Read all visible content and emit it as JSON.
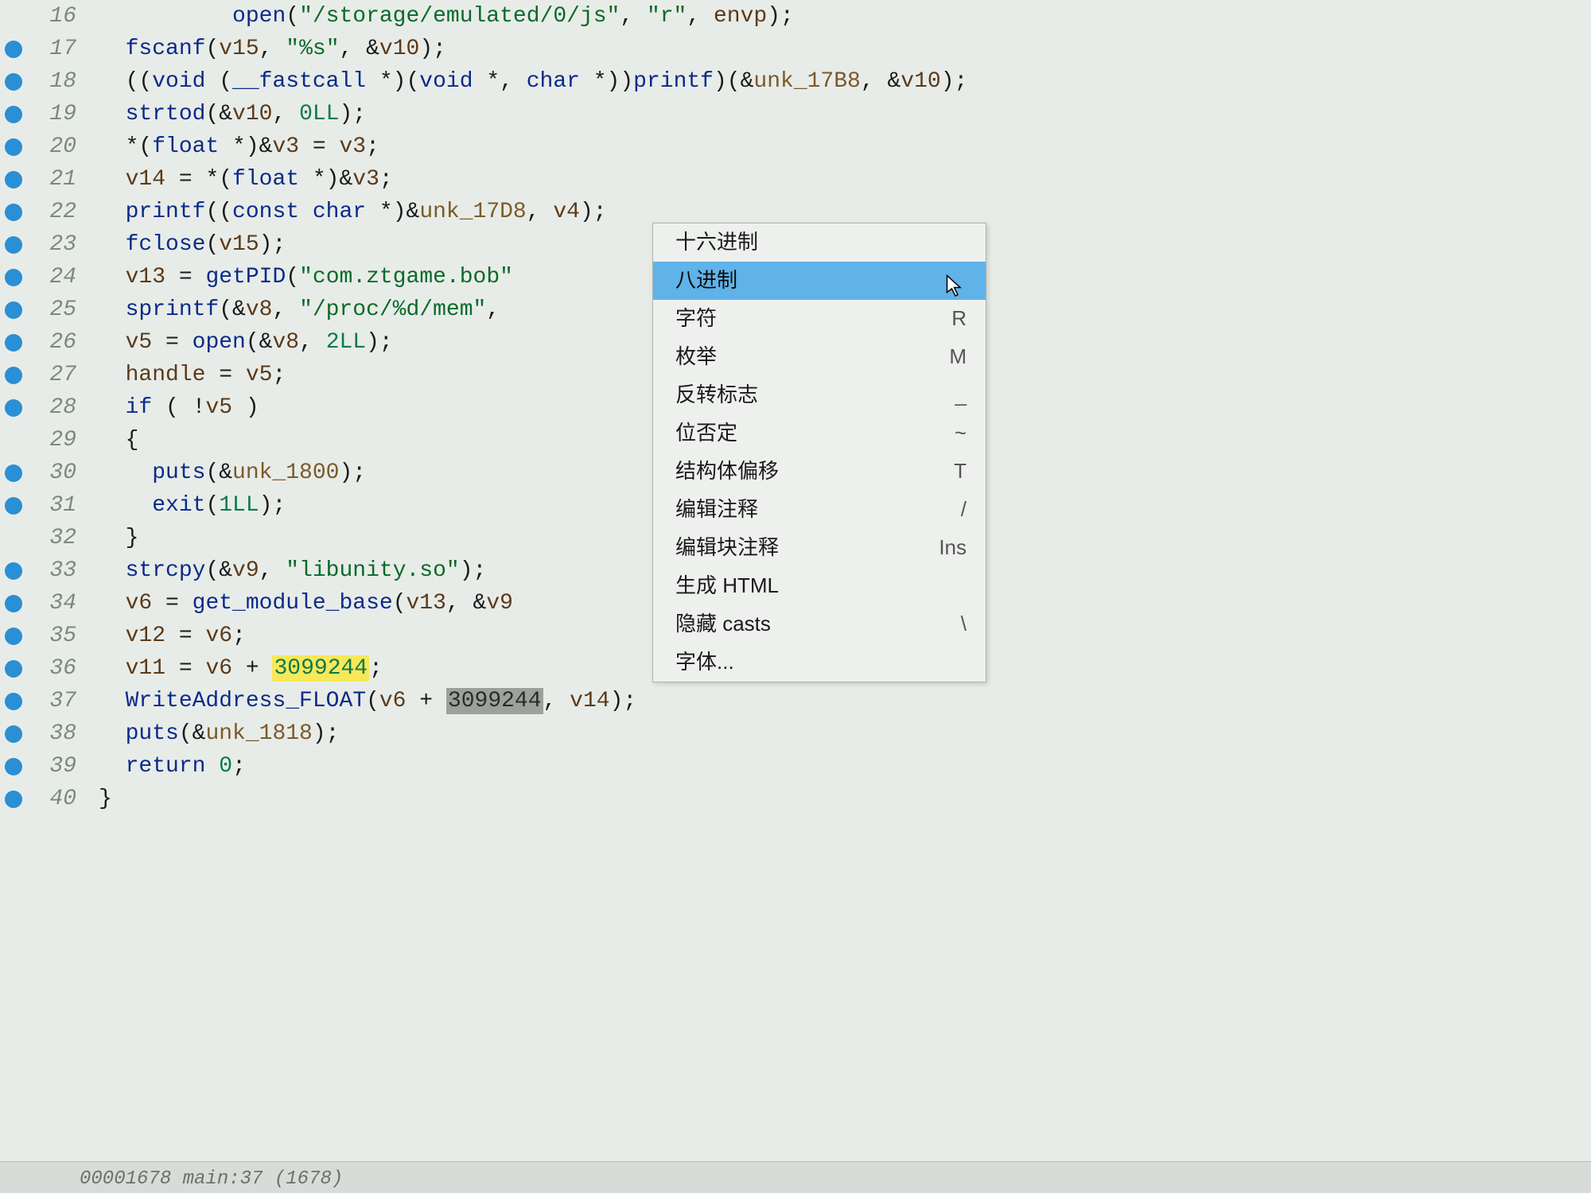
{
  "lines": [
    {
      "n": 16,
      "bp": false,
      "tokens": [
        {
          "t": "        ",
          "c": ""
        },
        {
          "t": "open",
          "c": "fn"
        },
        {
          "t": "(",
          "c": ""
        },
        {
          "t": "\"/storage/emulated/0/js\"",
          "c": "str"
        },
        {
          "t": ", ",
          "c": ""
        },
        {
          "t": "\"r\"",
          "c": "str"
        },
        {
          "t": ", ",
          "c": ""
        },
        {
          "t": "envp",
          "c": "var"
        },
        {
          "t": ");",
          "c": ""
        }
      ]
    },
    {
      "n": 17,
      "bp": true,
      "tokens": [
        {
          "t": "fscanf",
          "c": "fn"
        },
        {
          "t": "(",
          "c": ""
        },
        {
          "t": "v15",
          "c": "var"
        },
        {
          "t": ", ",
          "c": ""
        },
        {
          "t": "\"%s\"",
          "c": "str"
        },
        {
          "t": ", &",
          "c": ""
        },
        {
          "t": "v10",
          "c": "var"
        },
        {
          "t": ");",
          "c": ""
        }
      ]
    },
    {
      "n": 18,
      "bp": true,
      "tokens": [
        {
          "t": "((",
          "c": ""
        },
        {
          "t": "void",
          "c": "type"
        },
        {
          "t": " (",
          "c": ""
        },
        {
          "t": "__fastcall",
          "c": "type"
        },
        {
          "t": " *)(",
          "c": ""
        },
        {
          "t": "void",
          "c": "type"
        },
        {
          "t": " *, ",
          "c": ""
        },
        {
          "t": "char",
          "c": "type"
        },
        {
          "t": " *))",
          "c": ""
        },
        {
          "t": "printf",
          "c": "fn"
        },
        {
          "t": ")(&",
          "c": ""
        },
        {
          "t": "unk_17B8",
          "c": "ref"
        },
        {
          "t": ", &",
          "c": ""
        },
        {
          "t": "v10",
          "c": "var"
        },
        {
          "t": ");",
          "c": ""
        }
      ]
    },
    {
      "n": 19,
      "bp": true,
      "tokens": [
        {
          "t": "strtod",
          "c": "fn"
        },
        {
          "t": "(&",
          "c": ""
        },
        {
          "t": "v10",
          "c": "var"
        },
        {
          "t": ", ",
          "c": ""
        },
        {
          "t": "0LL",
          "c": "num"
        },
        {
          "t": ");",
          "c": ""
        }
      ]
    },
    {
      "n": 20,
      "bp": true,
      "tokens": [
        {
          "t": "*(",
          "c": ""
        },
        {
          "t": "float",
          "c": "type"
        },
        {
          "t": " *)&",
          "c": ""
        },
        {
          "t": "v3",
          "c": "var"
        },
        {
          "t": " = ",
          "c": ""
        },
        {
          "t": "v3",
          "c": "var"
        },
        {
          "t": ";",
          "c": ""
        }
      ]
    },
    {
      "n": 21,
      "bp": true,
      "tokens": [
        {
          "t": "v14",
          "c": "var"
        },
        {
          "t": " = *(",
          "c": ""
        },
        {
          "t": "float",
          "c": "type"
        },
        {
          "t": " *)&",
          "c": ""
        },
        {
          "t": "v3",
          "c": "var"
        },
        {
          "t": ";",
          "c": ""
        }
      ]
    },
    {
      "n": 22,
      "bp": true,
      "tokens": [
        {
          "t": "printf",
          "c": "fn"
        },
        {
          "t": "((",
          "c": ""
        },
        {
          "t": "const",
          "c": "type"
        },
        {
          "t": " ",
          "c": ""
        },
        {
          "t": "char",
          "c": "type"
        },
        {
          "t": " *)&",
          "c": ""
        },
        {
          "t": "unk_17D8",
          "c": "ref"
        },
        {
          "t": ", ",
          "c": ""
        },
        {
          "t": "v4",
          "c": "var"
        },
        {
          "t": ");",
          "c": ""
        }
      ]
    },
    {
      "n": 23,
      "bp": true,
      "tokens": [
        {
          "t": "fclose",
          "c": "fn"
        },
        {
          "t": "(",
          "c": ""
        },
        {
          "t": "v15",
          "c": "var"
        },
        {
          "t": ");",
          "c": ""
        }
      ]
    },
    {
      "n": 24,
      "bp": true,
      "tokens": [
        {
          "t": "v13",
          "c": "var"
        },
        {
          "t": " = ",
          "c": ""
        },
        {
          "t": "getPID",
          "c": "fn"
        },
        {
          "t": "(",
          "c": ""
        },
        {
          "t": "\"com.ztgame.bob\"",
          "c": "str"
        }
      ]
    },
    {
      "n": 25,
      "bp": true,
      "tokens": [
        {
          "t": "sprintf",
          "c": "fn"
        },
        {
          "t": "(&",
          "c": ""
        },
        {
          "t": "v8",
          "c": "var"
        },
        {
          "t": ", ",
          "c": ""
        },
        {
          "t": "\"/proc/%d/mem\"",
          "c": "str"
        },
        {
          "t": ",",
          "c": ""
        }
      ]
    },
    {
      "n": 26,
      "bp": true,
      "tokens": [
        {
          "t": "v5",
          "c": "var"
        },
        {
          "t": " = ",
          "c": ""
        },
        {
          "t": "open",
          "c": "fn"
        },
        {
          "t": "(&",
          "c": ""
        },
        {
          "t": "v8",
          "c": "var"
        },
        {
          "t": ", ",
          "c": ""
        },
        {
          "t": "2LL",
          "c": "num"
        },
        {
          "t": ");",
          "c": ""
        }
      ]
    },
    {
      "n": 27,
      "bp": true,
      "tokens": [
        {
          "t": "handle",
          "c": "var"
        },
        {
          "t": " = ",
          "c": ""
        },
        {
          "t": "v5",
          "c": "var"
        },
        {
          "t": ";",
          "c": ""
        }
      ]
    },
    {
      "n": 28,
      "bp": true,
      "tokens": [
        {
          "t": "if",
          "c": "kw"
        },
        {
          "t": " ( !",
          "c": ""
        },
        {
          "t": "v5",
          "c": "var"
        },
        {
          "t": " )",
          "c": ""
        }
      ]
    },
    {
      "n": 29,
      "bp": false,
      "tokens": [
        {
          "t": "{",
          "c": ""
        }
      ]
    },
    {
      "n": 30,
      "bp": true,
      "tokens": [
        {
          "t": "  ",
          "c": ""
        },
        {
          "t": "puts",
          "c": "fn"
        },
        {
          "t": "(&",
          "c": ""
        },
        {
          "t": "unk_1800",
          "c": "ref"
        },
        {
          "t": ");",
          "c": ""
        }
      ]
    },
    {
      "n": 31,
      "bp": true,
      "tokens": [
        {
          "t": "  ",
          "c": ""
        },
        {
          "t": "exit",
          "c": "fn"
        },
        {
          "t": "(",
          "c": ""
        },
        {
          "t": "1LL",
          "c": "num"
        },
        {
          "t": ");",
          "c": ""
        }
      ]
    },
    {
      "n": 32,
      "bp": false,
      "tokens": [
        {
          "t": "}",
          "c": ""
        }
      ]
    },
    {
      "n": 33,
      "bp": true,
      "tokens": [
        {
          "t": "strcpy",
          "c": "fn"
        },
        {
          "t": "(&",
          "c": ""
        },
        {
          "t": "v9",
          "c": "var"
        },
        {
          "t": ", ",
          "c": ""
        },
        {
          "t": "\"libunity.so\"",
          "c": "str"
        },
        {
          "t": ");",
          "c": ""
        }
      ]
    },
    {
      "n": 34,
      "bp": true,
      "tokens": [
        {
          "t": "v6",
          "c": "var"
        },
        {
          "t": " = ",
          "c": ""
        },
        {
          "t": "get_module_base",
          "c": "fn"
        },
        {
          "t": "(",
          "c": ""
        },
        {
          "t": "v13",
          "c": "var"
        },
        {
          "t": ", &",
          "c": ""
        },
        {
          "t": "v9",
          "c": "var"
        }
      ]
    },
    {
      "n": 35,
      "bp": true,
      "tokens": [
        {
          "t": "v12",
          "c": "var"
        },
        {
          "t": " = ",
          "c": ""
        },
        {
          "t": "v6",
          "c": "var"
        },
        {
          "t": ";",
          "c": ""
        }
      ]
    },
    {
      "n": 36,
      "bp": true,
      "tokens": [
        {
          "t": "v11",
          "c": "var"
        },
        {
          "t": " = ",
          "c": ""
        },
        {
          "t": "v6",
          "c": "var"
        },
        {
          "t": " + ",
          "c": ""
        },
        {
          "t": "3099244",
          "c": "num",
          "hl": "y"
        },
        {
          "t": ";",
          "c": ""
        }
      ]
    },
    {
      "n": 37,
      "bp": true,
      "tokens": [
        {
          "t": "WriteAddress_FLOAT",
          "c": "fn"
        },
        {
          "t": "(",
          "c": ""
        },
        {
          "t": "v6",
          "c": "var"
        },
        {
          "t": " + ",
          "c": ""
        },
        {
          "t": "3099244",
          "c": "num",
          "hl": "g"
        },
        {
          "t": ", ",
          "c": ""
        },
        {
          "t": "v14",
          "c": "var"
        },
        {
          "t": ");",
          "c": ""
        }
      ]
    },
    {
      "n": 38,
      "bp": true,
      "tokens": [
        {
          "t": "puts",
          "c": "fn"
        },
        {
          "t": "(&",
          "c": ""
        },
        {
          "t": "unk_1818",
          "c": "ref"
        },
        {
          "t": ");",
          "c": ""
        }
      ]
    },
    {
      "n": 39,
      "bp": true,
      "tokens": [
        {
          "t": "return",
          "c": "kw"
        },
        {
          "t": " ",
          "c": ""
        },
        {
          "t": "0",
          "c": "num"
        },
        {
          "t": ";",
          "c": ""
        }
      ]
    },
    {
      "n": 40,
      "bp": true,
      "tokens": [
        {
          "t": "}",
          "c": ""
        }
      ],
      "noindent": true
    }
  ],
  "menu": {
    "items": [
      {
        "label": "十六进制",
        "sc": "",
        "sel": false
      },
      {
        "label": "八进制",
        "sc": "",
        "sel": true
      },
      {
        "label": "字符",
        "sc": "R",
        "sel": false
      },
      {
        "label": "枚举",
        "sc": "M",
        "sel": false
      },
      {
        "label": "反转标志",
        "sc": "_",
        "sel": false
      },
      {
        "label": "位否定",
        "sc": "~",
        "sel": false
      },
      {
        "label": "结构体偏移",
        "sc": "T",
        "sel": false
      },
      {
        "label": "编辑注释",
        "sc": "/",
        "sel": false
      },
      {
        "label": "编辑块注释",
        "sc": "Ins",
        "sel": false
      },
      {
        "label": "生成 HTML",
        "sc": "",
        "sel": false
      },
      {
        "label": "隐藏 casts",
        "sc": "\\",
        "sel": false
      },
      {
        "label": "字体...",
        "sc": "",
        "sel": false
      }
    ]
  },
  "status": "00001678 main:37 (1678)"
}
